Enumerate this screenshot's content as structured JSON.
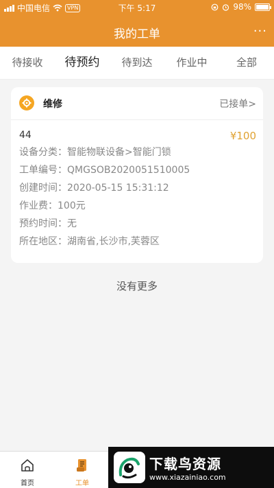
{
  "statusbar": {
    "carrier": "中国电信",
    "vpn": "VPN",
    "time": "下午 5:17",
    "battery": "98%",
    "battery_level": 0.98
  },
  "navbar": {
    "title": "我的工单",
    "more": "···"
  },
  "tabs": [
    {
      "label": "待接收",
      "active": false
    },
    {
      "label": "待预约",
      "active": true
    },
    {
      "label": "待到达",
      "active": false
    },
    {
      "label": "作业中",
      "active": false
    },
    {
      "label": "全部",
      "active": false
    }
  ],
  "order": {
    "type": "维修",
    "status": "已接单>",
    "name": "44",
    "price": "¥100",
    "rows": [
      {
        "label": "设备分类：",
        "value": "智能物联设备>智能门锁"
      },
      {
        "label": "工单编号：",
        "value": "QMGSOB2020051510005"
      },
      {
        "label": "创建时间：",
        "value": "2020-05-15 15:31:12"
      },
      {
        "label": "作业费：",
        "value": "100元"
      },
      {
        "label": "预约时间：",
        "value": "无"
      },
      {
        "label": "所在地区：",
        "value": "湖南省,长沙市,芙蓉区"
      }
    ]
  },
  "no_more": "没有更多",
  "tabbar": {
    "items": [
      {
        "label": "首页",
        "icon": "home-icon",
        "active": false
      },
      {
        "label": "工单",
        "icon": "order-icon",
        "active": true
      }
    ]
  },
  "watermark": {
    "title": "下载鸟资源",
    "url": "www.xiazainiao.com"
  },
  "colors": {
    "brand": "#e8922e",
    "price": "#e0a232",
    "icon": "#f5a623"
  }
}
